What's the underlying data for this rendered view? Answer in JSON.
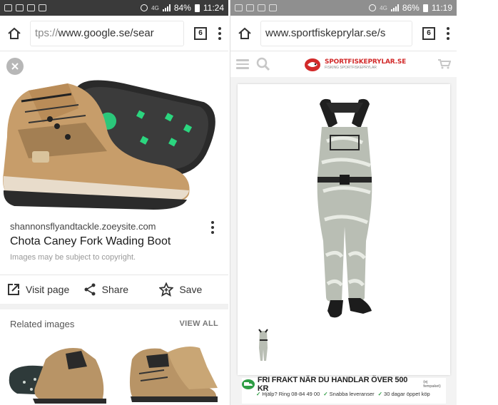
{
  "left_phone": {
    "status": {
      "battery": "84%",
      "time": "11:24",
      "network": "4G"
    },
    "url": {
      "scheme_fragment": "tps://",
      "host_fragment": "www.google.se/sear"
    },
    "tabs_count": "6",
    "result": {
      "domain": "shannonsflyandtackle.zoeysite.com",
      "title": "Chota Caney Fork Wading Boot",
      "disclaimer": "Images may be subject to copyright."
    },
    "actions": {
      "visit": "Visit page",
      "share": "Share",
      "save": "Save"
    },
    "related": {
      "title": "Related images",
      "view_all": "VIEW ALL"
    }
  },
  "right_phone": {
    "status": {
      "battery": "86%",
      "time": "11:19",
      "network": "4G"
    },
    "url": {
      "host_fragment": "www.sportfiskeprylar.se/s"
    },
    "tabs_count": "6",
    "site": {
      "logo_text": "SPORTFISKEPRYLAR.SE",
      "logo_subtext": "FISKING SPORTFISKEPRYLAR"
    },
    "banner": {
      "headline": "FRI FRAKT NÄR DU HANDLAR ÖVER 500 KR",
      "headline_note": "(ej fempaket)",
      "perks": [
        "Hjälp? Ring 08-84 49 00",
        "Snabba leveranser",
        "30 dagar öppet köp"
      ]
    }
  },
  "colors": {
    "accent_green": "#2e9d44",
    "logo_red": "#d22a2a",
    "header_rule": "#2f5f8f",
    "statusbar": "#3a3a3a"
  }
}
